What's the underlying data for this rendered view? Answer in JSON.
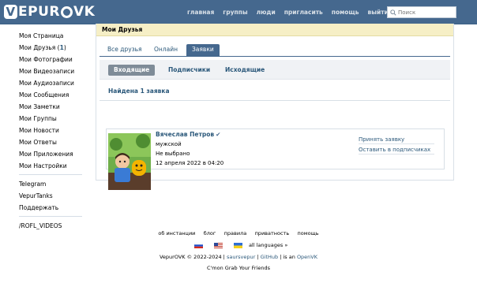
{
  "header": {
    "logo_text": "VEPUROVK",
    "nav": [
      "главная",
      "группы",
      "люди",
      "пригласить",
      "помощь",
      "выйти"
    ],
    "search_placeholder": "Поиск"
  },
  "sidebar": {
    "items": [
      {
        "label": "Моя Страница"
      },
      {
        "label": "Мои Друзья",
        "count": "1"
      },
      {
        "label": "Мои Фотографии"
      },
      {
        "label": "Мои Видеозаписи"
      },
      {
        "label": "Мои Аудиозаписи"
      },
      {
        "label": "Мои Сообщения"
      },
      {
        "label": "Мои Заметки"
      },
      {
        "label": "Мои Группы"
      },
      {
        "label": "Мои Новости"
      },
      {
        "label": "Мои Ответы"
      },
      {
        "label": "Мои Приложения"
      },
      {
        "label": "Мои Настройки"
      }
    ],
    "links": [
      "Telegram",
      "VepurTanks",
      "Поддержать"
    ],
    "groups": [
      "/ROFL_VIDEOS"
    ]
  },
  "main": {
    "title": "Мои Друзья",
    "tabs": [
      "Все друзья",
      "Онлайн",
      "Заявки"
    ],
    "active_tab": "Заявки",
    "subtabs": [
      "Входящие",
      "Подписчики",
      "Исходящие"
    ],
    "active_subtab": "Входящие",
    "found_text": "Найдена 1 заявка",
    "request": {
      "name": "Вячеслав Петров",
      "verified_mark": "✔",
      "gender": "мужской",
      "status": "Не выбрано",
      "date": "12 апреля 2022 в 04:20",
      "actions": [
        "Принять заявку",
        "Оставить в подписчиках"
      ]
    }
  },
  "footer": {
    "links": [
      "об инстанции",
      "блог",
      "правила",
      "приватность",
      "помощь"
    ],
    "languages_label": "all languages »",
    "copyright_prefix": "VepurOVK © 2022-2024 |",
    "author_link": "saursvepur",
    "github_sep": "|",
    "github_link": "GitHub",
    "is_an": "| is an",
    "openvk_link": "OpenVK",
    "slogan": "C'mon Grab Your Friends"
  },
  "colors": {
    "header": "#45688e",
    "link": "#2b587a",
    "title_bar": "#f6efc6",
    "active_subtab": "#7f8c98"
  }
}
